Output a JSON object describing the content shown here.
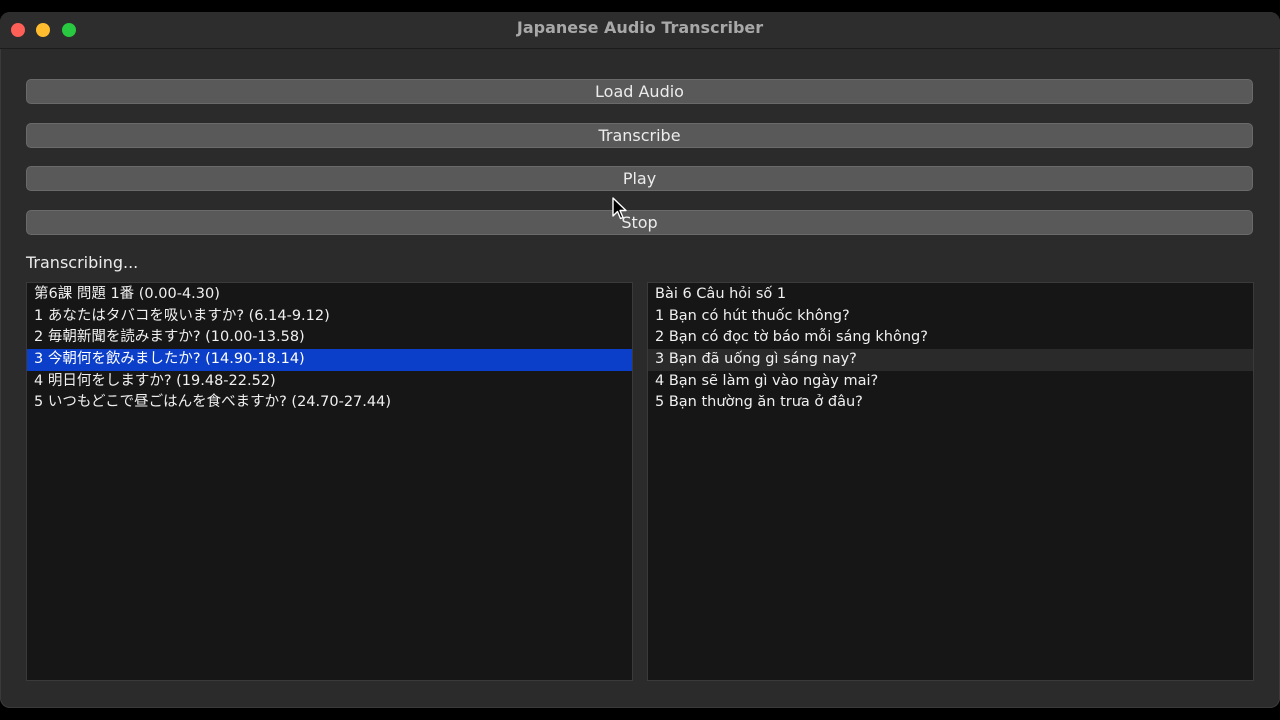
{
  "window": {
    "title": "Japanese Audio Transcriber"
  },
  "buttons": {
    "load_audio": "Load Audio",
    "transcribe": "Transcribe",
    "play": "Play",
    "stop": "Stop"
  },
  "status": "Transcribing...",
  "japanese_list": {
    "selected_index": 3,
    "items": [
      "第6課 問題 1番 (0.00-4.30)",
      "1 あなたはタバコを吸いますか? (6.14-9.12)",
      "2 毎朝新聞を読みますか? (10.00-13.58)",
      "3 今朝何を飲みましたか? (14.90-18.14)",
      "4 明日何をしますか? (19.48-22.52)",
      "5 いつもどこで昼ごはんを食べますか? (24.70-27.44)"
    ]
  },
  "vietnamese_list": {
    "highlight_index": 3,
    "items": [
      "Bài 6 Câu hỏi số 1",
      "1 Bạn có hút thuốc không?",
      "2 Bạn có đọc tờ báo mỗi sáng không?",
      "3 Bạn đã uống gì sáng nay?",
      "4 Bạn sẽ làm gì vào ngày mai?",
      "5 Bạn thường ăn trưa ở đâu?"
    ]
  },
  "colors": {
    "selection": "#0b3fc9",
    "window_bg": "#2b2b2b",
    "button_bg": "#595959"
  }
}
